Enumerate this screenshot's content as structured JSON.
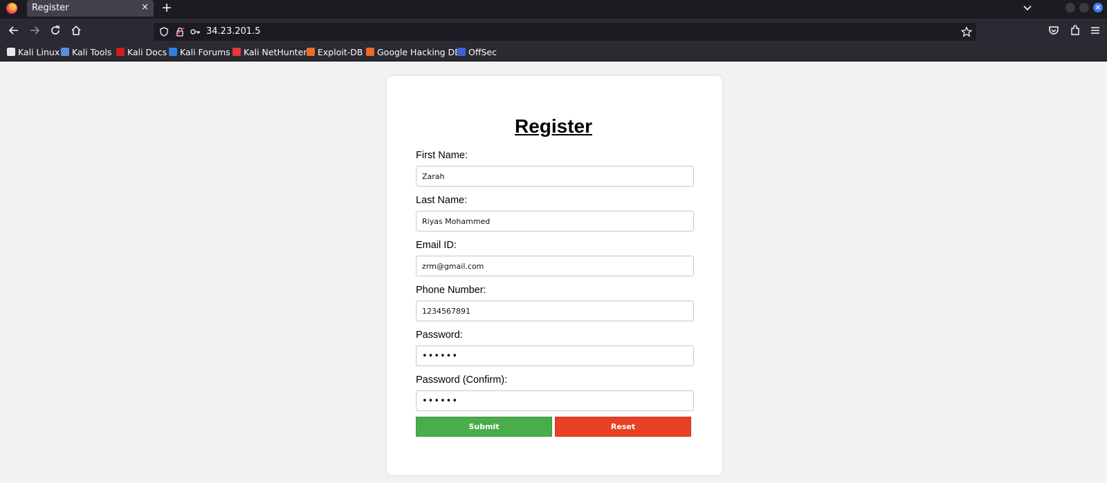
{
  "browser": {
    "tab_title": "Register",
    "tab_close": "×",
    "new_tab": "+",
    "url": "34.23.201.5",
    "window_close_glyph": "×",
    "bookmarks": [
      {
        "label": "Kali Linux",
        "icon": "kali-dragon-icon",
        "color": "#e8e8e8"
      },
      {
        "label": "Kali Tools",
        "icon": "kali-tools-icon",
        "color": "#5a8de0"
      },
      {
        "label": "Kali Docs",
        "icon": "kali-docs-icon",
        "color": "#d21e1e"
      },
      {
        "label": "Kali Forums",
        "icon": "kali-forums-icon",
        "color": "#2f7fe0"
      },
      {
        "label": "Kali NetHunter",
        "icon": "kali-nethunter-icon",
        "color": "#e03a3a"
      },
      {
        "label": "Exploit-DB",
        "icon": "exploit-db-icon",
        "color": "#ec6a2a"
      },
      {
        "label": "Google Hacking DB",
        "icon": "ghdb-icon",
        "color": "#ec6a2a"
      },
      {
        "label": "OffSec",
        "icon": "offsec-icon",
        "color": "#3c63d8"
      }
    ]
  },
  "form": {
    "title": "Register",
    "fields": [
      {
        "label": "First Name:",
        "value": "Zarah"
      },
      {
        "label": "Last Name:",
        "value": "Riyas Mohammed"
      },
      {
        "label": "Email ID:",
        "value": "zrm@gmail.com"
      },
      {
        "label": "Phone Number:",
        "value": "1234567891"
      },
      {
        "label": "Password:",
        "value": "••••••"
      },
      {
        "label": "Password (Confirm):",
        "value": "••••••"
      }
    ],
    "submit_label": "Submit",
    "reset_label": "Reset"
  },
  "colors": {
    "submit": "#49ad4c",
    "reset": "#e84125",
    "page_background": "#f2f2f2"
  }
}
